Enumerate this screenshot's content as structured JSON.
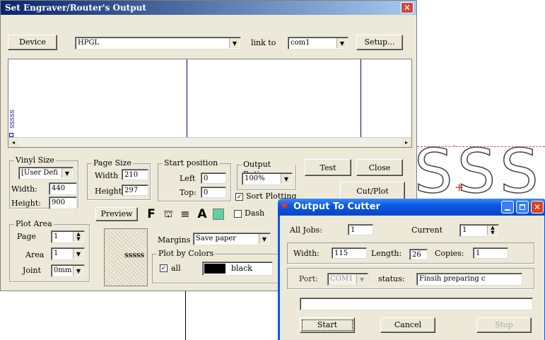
{
  "main_dialog": {
    "title": "Set Engraver/Router's Output",
    "device_button": "Device",
    "device_value": "HPGL",
    "link_to_label": "link to",
    "port_value": "com1",
    "setup_button": "Setup...",
    "vinyl_size": {
      "label": "Vinyl Size",
      "select_value": "[User Defi",
      "width_label": "Width:",
      "width_value": "440",
      "height_label": "Height:",
      "height_value": "900"
    },
    "page_size": {
      "label": "Page Size",
      "width_label": "Width",
      "width_value": "210",
      "height_label": "Height",
      "height_value": "297"
    },
    "start_position": {
      "label": "Start position",
      "left_label": "Left",
      "left_value": "0",
      "top_label": "Top:",
      "top_value": "0"
    },
    "output_ratio": {
      "label": "Output Ratio",
      "value": "100%"
    },
    "test_button": "Test",
    "close_button": "Close",
    "sort_plotting_label": "Sort Plotting",
    "cut_plot_button": "Cut/Plot",
    "preview_button": "Preview",
    "dash_label": "Dash",
    "plot_area": {
      "label": "Plot Area",
      "page_label": "Page",
      "page_value": "1",
      "area_label": "Area",
      "area_value": "1",
      "joint_label": "Joint",
      "joint_value": "0mm"
    },
    "thumb_text": "SSSSS",
    "preview_text": "SSSSS",
    "margins_label": "Margins",
    "margins_value": "Save paper",
    "plot_by_colors": {
      "label": "Plot by Colors",
      "all_label": "all",
      "color_name": "black"
    }
  },
  "canvas": {
    "outline_text": "SSS"
  },
  "output_dialog": {
    "title": "Output To Cutter",
    "all_jobs_label": "All Jobs:",
    "all_jobs_value": "1",
    "current_label": "Current",
    "current_value": "1",
    "width_label": "Width:",
    "width_value": "115",
    "length_label": "Length:",
    "length_value": "26",
    "copies_label": "Copies:",
    "copies_value": "1",
    "port_label": "Port:",
    "port_value": "COM1",
    "status_label": "status:",
    "status_value": "Finsih preparing c",
    "start_button": "Start",
    "cancel_button": "Cancel",
    "stop_button": "Stop"
  },
  "colors": {
    "main_titlebar": "#0a246a",
    "xp_titlebar": "#0a58e5",
    "dialog_bg": "#ece9d8",
    "close_red": "#e04020"
  }
}
